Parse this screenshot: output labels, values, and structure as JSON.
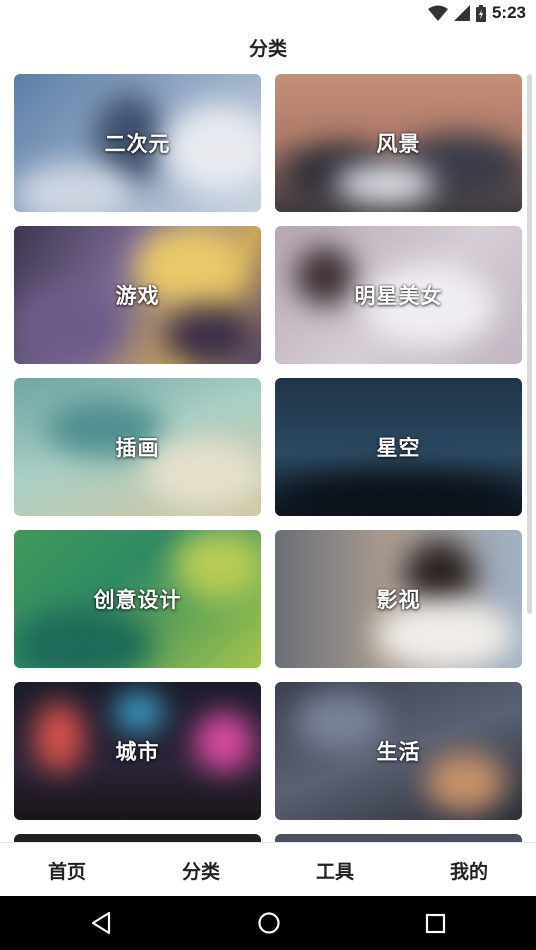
{
  "status_bar": {
    "time": "5:23"
  },
  "page": {
    "title": "分类"
  },
  "categories": [
    {
      "label": "二次元"
    },
    {
      "label": "风景"
    },
    {
      "label": "游戏"
    },
    {
      "label": "明星美女"
    },
    {
      "label": "插画"
    },
    {
      "label": "星空"
    },
    {
      "label": "创意设计"
    },
    {
      "label": "影视"
    },
    {
      "label": "城市"
    },
    {
      "label": "生活"
    }
  ],
  "bottom_nav": {
    "items": [
      {
        "label": "首页"
      },
      {
        "label": "分类"
      },
      {
        "label": "工具"
      },
      {
        "label": "我的"
      }
    ]
  },
  "icons": {
    "wifi": "wifi-icon",
    "signal": "signal-icon",
    "battery": "battery-icon",
    "back": "back-icon",
    "home": "home-icon",
    "recents": "recents-icon"
  }
}
